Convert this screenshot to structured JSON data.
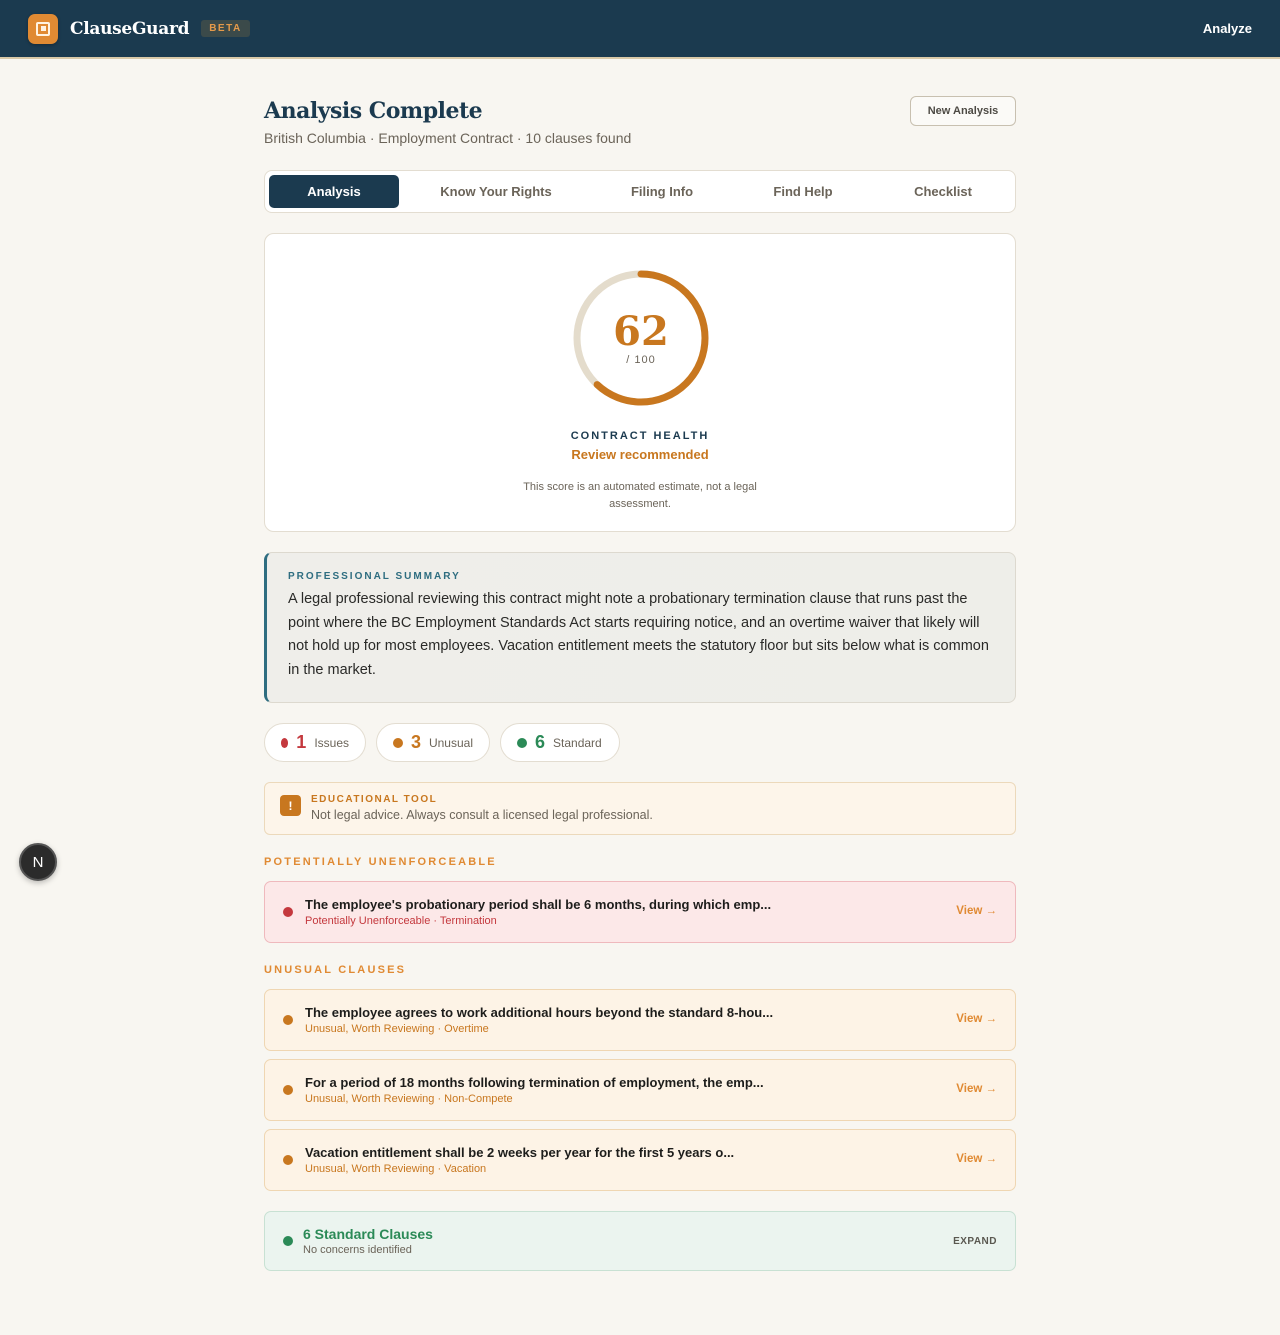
{
  "header": {
    "brand": "ClauseGuard",
    "badge": "BETA",
    "nav_analyze": "Analyze"
  },
  "main": {
    "title": "Analysis Complete",
    "subtitle": "British Columbia · Employment Contract · 10 clauses found",
    "new_analysis_button": "New Analysis",
    "tabs": [
      {
        "label": "Analysis",
        "active": true
      },
      {
        "label": "Know Your Rights",
        "active": false
      },
      {
        "label": "Filing Info",
        "active": false
      },
      {
        "label": "Find Help",
        "active": false
      },
      {
        "label": "Checklist",
        "active": false
      }
    ]
  },
  "score": {
    "value": "62",
    "out_of": "/ 100",
    "fraction": 0.62,
    "label": "CONTRACT HEALTH",
    "status": "Review recommended",
    "note": "This score is an automated estimate, not a legal assessment."
  },
  "summary": {
    "label": "PROFESSIONAL SUMMARY",
    "text": "A legal professional reviewing this contract might note a probationary termination clause that runs past the point where the BC Employment Standards Act starts requiring notice, and an overtime waiver that likely will not hold up for most employees. Vacation entitlement meets the statutory floor but sits below what is common in the market."
  },
  "counts": [
    {
      "count": "1",
      "label": "Issues",
      "color": "#c4393e"
    },
    {
      "count": "3",
      "label": "Unusual",
      "color": "#c8771f"
    },
    {
      "count": "6",
      "label": "Standard",
      "color": "#2b8a57"
    }
  ],
  "educational": {
    "icon": "!",
    "title": "EDUCATIONAL TOOL",
    "text": "Not legal advice. Always consult a licensed legal professional."
  },
  "sections": {
    "unenforceable_label": "POTENTIALLY UNENFORCEABLE",
    "unusual_label": "UNUSUAL CLAUSES"
  },
  "unenforceable_clauses": [
    {
      "title": "The employee's probationary period shall be 6 months, during which emp...",
      "meta": "Potentially Unenforceable · Termination",
      "action": "View →"
    }
  ],
  "unusual_clauses": [
    {
      "title": "The employee agrees to work additional hours beyond the standard 8-hou...",
      "meta": "Unusual, Worth Reviewing · Overtime",
      "action": "View →"
    },
    {
      "title": "For a period of 18 months following termination of employment, the emp...",
      "meta": "Unusual, Worth Reviewing · Non-Compete",
      "action": "View →"
    },
    {
      "title": "Vacation entitlement shall be 2 weeks per year for the first 5 years o...",
      "meta": "Unusual, Worth Reviewing · Vacation",
      "action": "View →"
    }
  ],
  "standard": {
    "title": "6 Standard Clauses",
    "subtitle": "No concerns identified",
    "action": "EXPAND"
  },
  "fab": {
    "label": "N"
  },
  "colors": {
    "navy": "#1b3a4f",
    "accent": "#c8771f",
    "issue": "#c4393e",
    "ok": "#2b8a57"
  }
}
